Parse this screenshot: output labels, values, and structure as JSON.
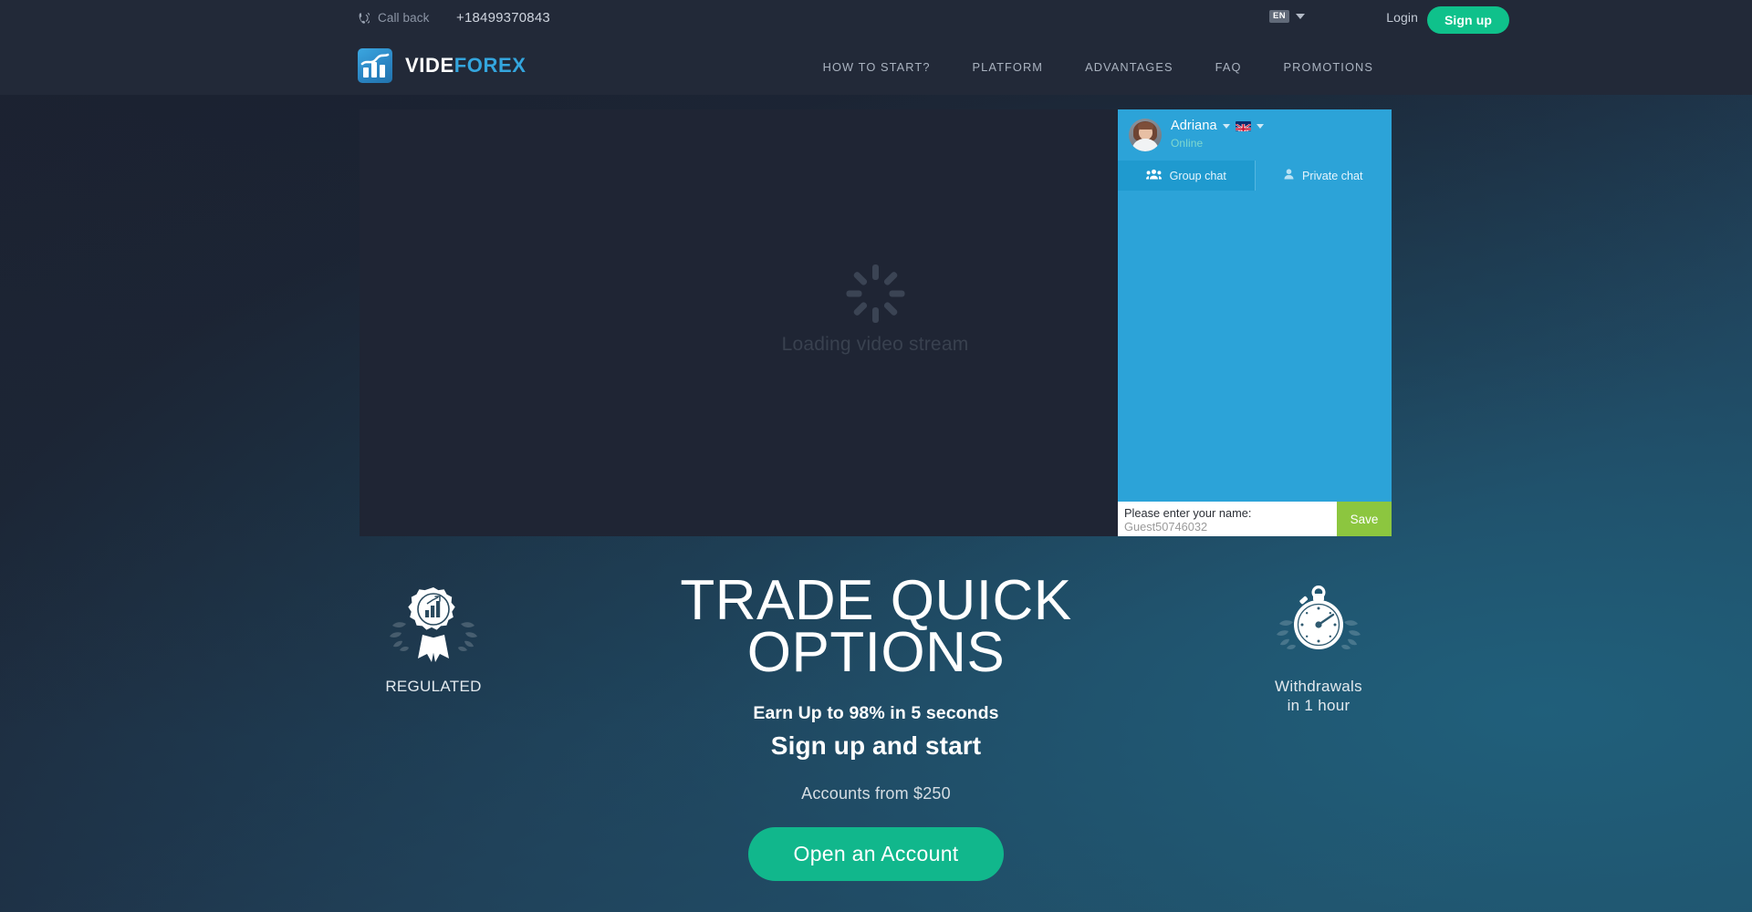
{
  "topbar": {
    "callback_icon": "phone-callback-icon",
    "callback_label": "Call back",
    "phone": "+18499370843",
    "language": "EN",
    "login_label": "Login",
    "signup_label": "Sign up"
  },
  "header": {
    "logo_part1": "VIDE",
    "logo_part2": "FOREX",
    "logo_icon": "videforex-chart-logo-icon",
    "nav": [
      {
        "label": "HOW TO START?"
      },
      {
        "label": "PLATFORM"
      },
      {
        "label": "ADVANTAGES"
      },
      {
        "label": "FAQ"
      },
      {
        "label": "PROMOTIONS"
      }
    ]
  },
  "video": {
    "loading_text": "Loading video stream",
    "collapse_icon": "arrow-left-icon"
  },
  "chat": {
    "agent_name": "Adriana",
    "agent_status": "Online",
    "agent_language_flag": "uk-flag-icon",
    "tabs": [
      {
        "label": "Group chat",
        "icon": "group-users-icon",
        "active": true
      },
      {
        "label": "Private chat",
        "icon": "single-user-icon",
        "active": false
      }
    ],
    "name_prompt": "Please enter your name:",
    "name_value": "Guest50746032",
    "name_placeholder": "Guest50746032",
    "save_label": "Save"
  },
  "hero": {
    "title_line1": "TRADE QUICK",
    "title_line2": "OPTIONS",
    "sub1": "Earn Up to 98% in 5 seconds",
    "sub2": "Sign up and start",
    "note": "Accounts from $250",
    "cta_label": "Open an Account"
  },
  "badges": {
    "left": {
      "icon": "regulated-medal-icon",
      "caption": "REGULATED"
    },
    "right": {
      "icon": "stopwatch-icon",
      "caption_line1": "Withdrawals",
      "caption_line2": "in 1 hour"
    }
  },
  "colors": {
    "accent_green": "#0fc18b",
    "cta_green": "#11b78c",
    "save_green": "#8cc63f",
    "chat_blue": "#2ca3d8",
    "logo_blue": "#34a5dd",
    "topbar_bg": "#222938"
  }
}
